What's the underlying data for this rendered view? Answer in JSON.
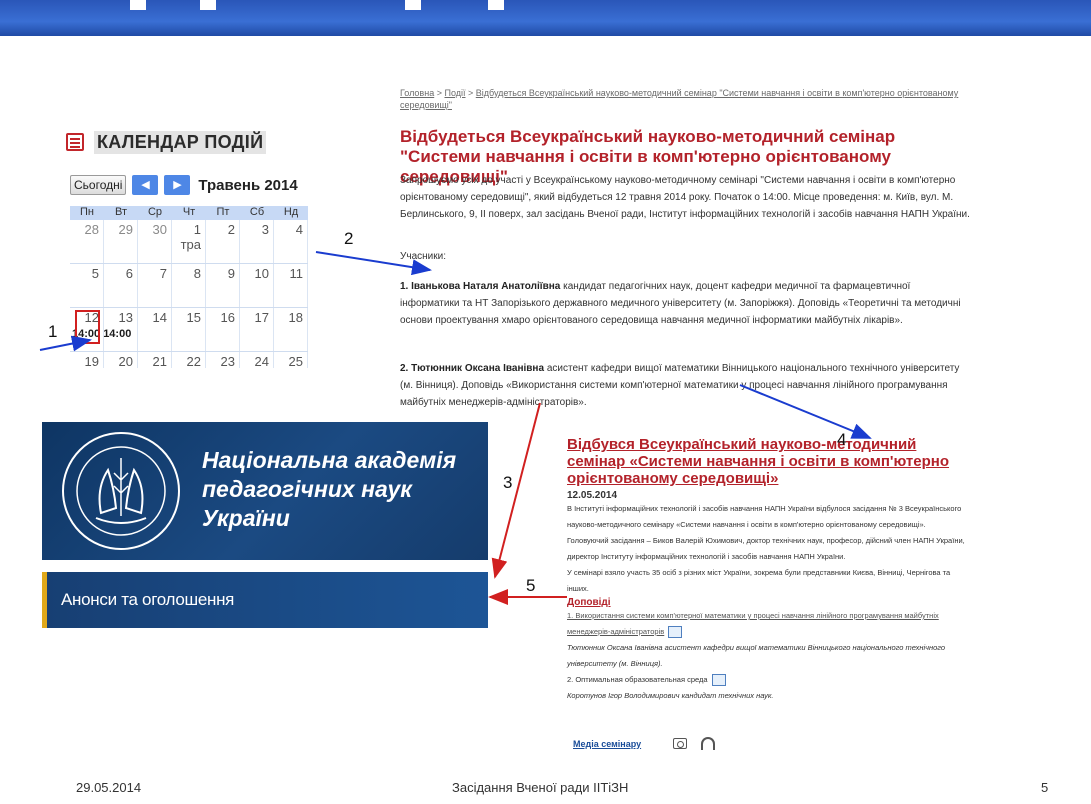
{
  "calendar": {
    "title": "КАЛЕНДАР ПОДІЙ",
    "today_button": "Сьогодні",
    "month": "Травень 2014",
    "weekdays": [
      "Пн",
      "Вт",
      "Ср",
      "Чт",
      "Пт",
      "Сб",
      "Нд"
    ],
    "weeks": [
      [
        "28",
        "29",
        "30",
        "1 тра",
        "2",
        "3",
        "4"
      ],
      [
        "5",
        "6",
        "7",
        "8",
        "9",
        "10",
        "11"
      ],
      [
        "12",
        "13",
        "14",
        "15",
        "16",
        "17",
        "18"
      ],
      [
        "19",
        "20",
        "21",
        "22",
        "23",
        "24",
        "25"
      ]
    ],
    "event_time": "14:00 14:00"
  },
  "news": {
    "breadcrumb_home": "Головна",
    "breadcrumb_events": "Події",
    "breadcrumb_current": "Відбудеться Всеукраїнський науково-методичний семінар \"Системи навчання і освіти в комп'ютерно орієнтованому середовищі\"",
    "title": "Відбудеться Всеукраїнський науково-методичний семінар \"Системи навчання і освіти в комп'ютерно орієнтованому середовищі\"",
    "body": "Запрошуємо усіх до участі у Всеукраїнському науково-методичному семінарі \"Системи навчання і освіти в комп'ютерно орієнтованому середовищі\", який відбудеться 12 травня 2014 року. Початок о 14:00. Місце проведення: м. Київ, вул. М. Берлинського, 9, ІІ поверх, зал засідань Вченої ради, Інститут інформаційних технологій і засобів навчання НАПН України.",
    "participants_label": "Учасники:",
    "participant1_name": "1. Іванькова Наталя Анатоліївна",
    "participant1_text": "кандидат педагогічних наук, доцент кафедри медичної та фармацевтичної інформатики та НТ Запорізького державного медичного університету (м. Запоріжжя). Доповідь «Теоретичні та методичні основи проектування хмаро орієнтованого середовища навчання медичної інформатики майбутніх лікарів».",
    "participant2_name": "2. Тютюнник Оксана Іванівна",
    "participant2_text": "асистент кафедри вищої математики Вінницького національного технічного університету (м. Вінниця). Доповідь «Використання системи комп'ютерної математики у процесі навчання лінійного програмування майбутніх менеджерів-адміністраторів»."
  },
  "academy": {
    "name": "Національна академія педагогічних наук України",
    "announcements": "Анонси та оголошення"
  },
  "event": {
    "title": "Відбувся Всеукраїнський науково-методичний семінар «Системи навчання і освіти в комп'ютерно орієнтованому середовищі»",
    "date": "12.05.2014",
    "text1": "В Інституті інформаційних технологій і засобів навчання НАПН України відбулося засідання № 3 Всеукраїнського науково-методичного семінару «Системи навчання і освіти в комп'ютерно орієнтованому середовищі».",
    "text2": "Головуючий засідання – Биков Валерій Юхимович, доктор технічних наук, професор, дійсний член НАПН України, директор Інституту інформаційних технологій і засобів навчання НАПН України.",
    "text3": "У семінарі взяло участь 35 осіб з різних міст України, зокрема були представники Києва, Вінниці, Чернігова та інших.",
    "reports_label": "Доповіді",
    "report1": "1. Використання системи комп'ютерної математики у процесі навчання лінійного програмування майбутніх менеджерів-адміністраторів",
    "report1_author": "Тютюнник Оксана Іванівна асистент кафедри вищої математики Вінницького національного технічного університету (м. Вінниця).",
    "report2": "2. Оптимальная образовательная среда",
    "report2_author": "Коротунов Ігор Володимирович кандидат технічних наук.",
    "media_label": "Медіа семінару"
  },
  "annotations": [
    "1",
    "2",
    "3",
    "4",
    "5"
  ],
  "footer": {
    "date": "29.05.2014",
    "title": "Засідання Вченої ради ІІТіЗН",
    "page": "5"
  },
  "colors": {
    "accent_red": "#b3222a",
    "arrow_blue": "#1a3ccf",
    "arrow_red": "#d12020",
    "banner_blue": "#1b4a82"
  }
}
